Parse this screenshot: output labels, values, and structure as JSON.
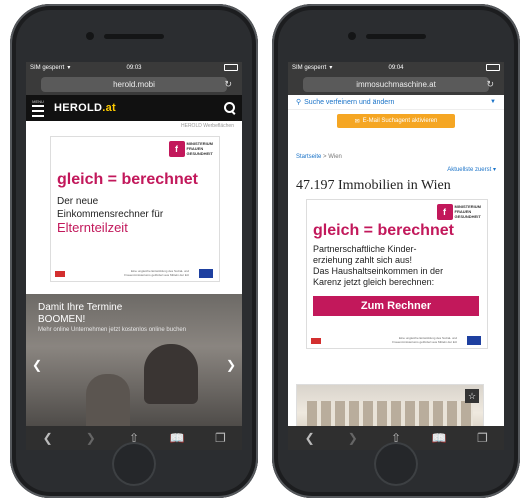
{
  "left_phone": {
    "status": {
      "carrier": "SIM gesperrt",
      "time": "09:03"
    },
    "url": "herold.mobi",
    "header": {
      "menu_label": "MENU",
      "logo": "HEROLD",
      "logo_tld": ".at"
    },
    "ad_tag": "HEROLD Werbeflächen",
    "ad": {
      "ministry": "MINISTERIUM\nFRAUEN\nGESUNDHEIT",
      "headline": "gleich = berechnet",
      "line1": "Der neue",
      "line2": "Einkommensrechner für",
      "line3": "Elternteilzeit",
      "footnote": "Eine ungleiche Entwicklung des Sozial- und Frauenministeriums gefördert aus Mitteln der EU"
    },
    "hero": {
      "title_line1": "Damit Ihre Termine",
      "title_line2": "BOOMEN!",
      "subtitle": "Mehr online Unternehmen jetzt kostenlos online buchen"
    }
  },
  "right_phone": {
    "status": {
      "carrier": "SIM gesperrt",
      "time": "09:04"
    },
    "url": "immosuchmaschine.at",
    "refine_link": "Suche verfeinern und ändern",
    "email_button": "E-Mail Suchagent aktivieren",
    "breadcrumb": {
      "home": "Startseite",
      "current": "Wien"
    },
    "sort_label": "Aktuellste zuerst",
    "result_count": "47.197 Immobilien in Wien",
    "ad": {
      "ministry": "MINISTERIUM\nFRAUEN\nGESUNDHEIT",
      "headline": "gleich = berechnet",
      "line1": "Partnerschaftliche Kinder-",
      "line2": "erziehung zahlt sich aus!",
      "line3": "Das Haushaltseinkommen in der",
      "line4": "Karenz jetzt gleich berechnen:",
      "cta": "Zum Rechner",
      "footnote": "Eine ungleiche Entwicklung des Sozial- und Frauenministeriums gefördert aus Mitteln der EU"
    }
  },
  "colors": {
    "brand_pink": "#c2185b",
    "herold_yellow": "#ffcc00",
    "link_blue": "#1a73c8",
    "mail_orange": "#f5a623"
  },
  "icons": [
    "wifi-icon",
    "battery-icon",
    "reload-icon",
    "menu-icon",
    "search-icon",
    "back-icon",
    "forward-icon",
    "share-icon",
    "bookmarks-icon",
    "tabs-icon",
    "star-icon",
    "chevron-down-icon"
  ]
}
